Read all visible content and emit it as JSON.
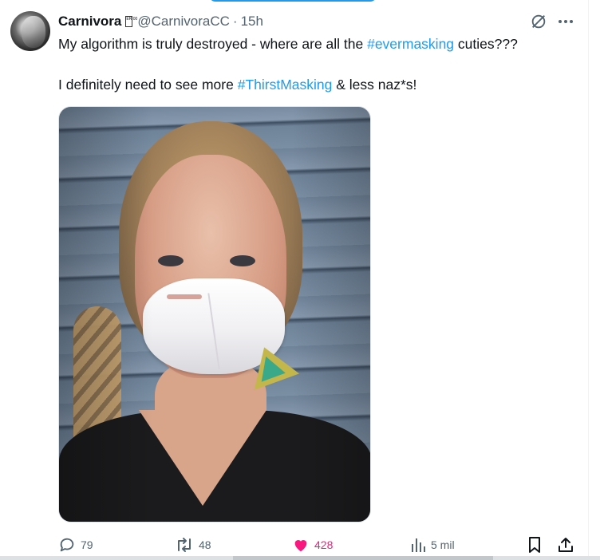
{
  "tweet": {
    "author_name": "Carnivora",
    "author_badge": "ER 00",
    "handle": "@CarnivoraCC",
    "separator": "·",
    "time": "15h",
    "line1": {
      "before": "My algorithm is truly destroyed - where are all the ",
      "hashtag": "#evermasking",
      "after": " cuties???"
    },
    "line2": {
      "before": "I definitely need to see more ",
      "hashtag": "#ThirstMasking",
      "after": " & less naz*s!"
    }
  },
  "actions": {
    "reply_count": "79",
    "repost_count": "48",
    "like_count": "428",
    "views_count": "5 mil"
  },
  "colors": {
    "accent": "#1d9bf0",
    "like": "#f91880",
    "muted": "#536471"
  },
  "icons": [
    "grok-icon",
    "more-icon",
    "reply-icon",
    "repost-icon",
    "heart-icon",
    "views-icon",
    "bookmark-icon",
    "share-icon"
  ]
}
